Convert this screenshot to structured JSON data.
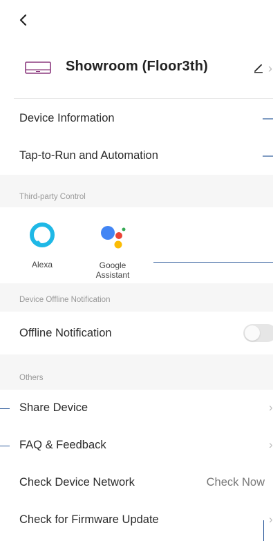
{
  "header": {
    "device_name": "Showroom (Floor3th)"
  },
  "rows_top": [
    {
      "label": "Device Information"
    },
    {
      "label": "Tap-to-Run and Automation"
    }
  ],
  "third_party": {
    "section_label": "Third-party Control",
    "items": [
      {
        "label": "Alexa"
      },
      {
        "label": "Google\nAssistant"
      }
    ]
  },
  "offline": {
    "section_label": "Device Offline Notification",
    "row_label": "Offline Notification",
    "toggle_on": false
  },
  "others": {
    "section_label": "Others",
    "rows": [
      {
        "label": "Share Device"
      },
      {
        "label": "FAQ & Feedback"
      },
      {
        "label": "Check Device Network",
        "value": "Check Now"
      },
      {
        "label": "Check for Firmware Update"
      }
    ]
  },
  "colors": {
    "alexa": "#1fb8e6",
    "google_blue": "#4285f4",
    "google_red": "#ea4335",
    "google_yellow": "#fbbc05",
    "google_green": "#34a853",
    "device_icon": "#8c3a7e",
    "annotation": "#2d5b9b"
  }
}
